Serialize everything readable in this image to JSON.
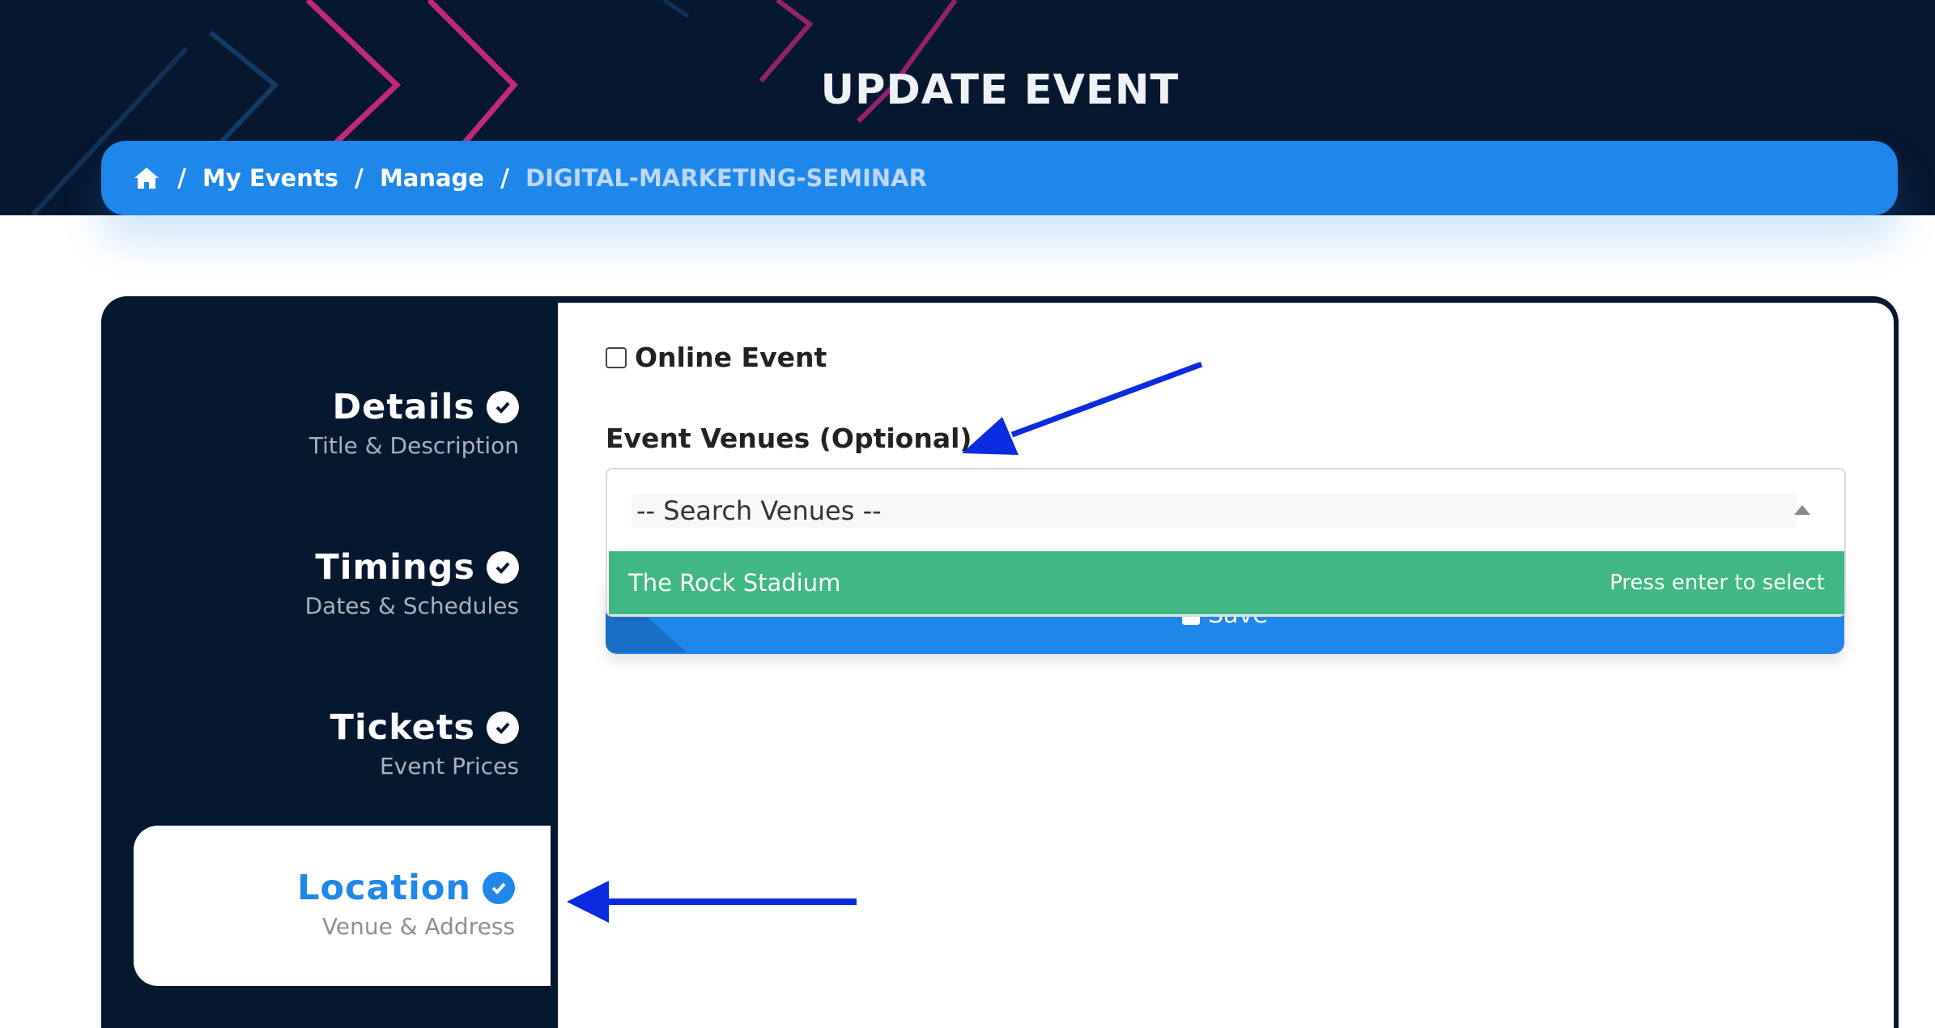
{
  "header": {
    "title": "UPDATE EVENT"
  },
  "breadcrumb": {
    "items": [
      "My Events",
      "Manage",
      "DIGITAL-MARKETING-SEMINAR"
    ],
    "separator": "/"
  },
  "sidebar": {
    "steps": [
      {
        "title": "Details",
        "subtitle": "Title & Description",
        "completed": true,
        "active": false
      },
      {
        "title": "Timings",
        "subtitle": "Dates & Schedules",
        "completed": true,
        "active": false
      },
      {
        "title": "Tickets",
        "subtitle": "Event Prices",
        "completed": true,
        "active": false
      },
      {
        "title": "Location",
        "subtitle": "Venue & Address",
        "completed": true,
        "active": true
      }
    ]
  },
  "form": {
    "online_event_label": "Online Event",
    "online_event_checked": false,
    "venues_label": "Event Venues (Optional)",
    "venues_search_placeholder": "-- Search Venues --",
    "venues_option": "The Rock Stadium",
    "venues_option_hint": "Press enter to select",
    "save_label": "Save"
  },
  "colors": {
    "primary": "#1f87e9",
    "dark": "#061730",
    "option_highlight": "#41b883",
    "annotation_arrow": "#0a2be0"
  }
}
